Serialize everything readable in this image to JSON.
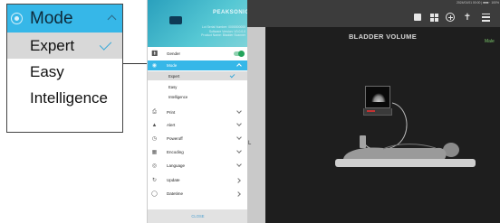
{
  "callout": {
    "header_label": "Mode",
    "options": [
      "Expert",
      "Easy",
      "Intelligence"
    ],
    "selected_index": 0
  },
  "menu": {
    "brand": "PEAKSONIC",
    "info_lines": [
      "Lot Serial Number: 0000000000",
      "Software Version: V0.0.0.0",
      "Product Name: Bladder Scanner"
    ],
    "items": [
      {
        "label": "Gender",
        "icon": "person-icon",
        "control": "toggle",
        "toggle_on": true
      },
      {
        "label": "Mode",
        "icon": "mode-icon",
        "control": "chevron-up",
        "expanded": true
      },
      {
        "label": "Print",
        "icon": "print-icon",
        "control": "chevron-down"
      },
      {
        "label": "Alert",
        "icon": "bell-icon",
        "control": "chevron-down"
      },
      {
        "label": "Poweroff",
        "icon": "clock-icon",
        "control": "chevron-down"
      },
      {
        "label": "Encoding",
        "icon": "qr-icon",
        "control": "chevron-down"
      },
      {
        "label": "Language",
        "icon": "globe-icon",
        "control": "chevron-down"
      },
      {
        "label": "Update",
        "icon": "refresh-icon",
        "control": "chevron-right"
      },
      {
        "label": "Datetime",
        "icon": "calendar-icon",
        "control": "chevron-right"
      }
    ],
    "mode_options": [
      "Expert",
      "Easy",
      "Intelligence"
    ],
    "mode_selected_index": 0,
    "footer_label": "CLOSE"
  },
  "app": {
    "status_text": "2024/01/01 00:00 | ■■■ · 100%",
    "title": "BLADDER VOLUME",
    "gender_label": "Male",
    "left_strip_text": "L",
    "toolbar_icons": [
      "square-icon",
      "grid-icon",
      "add-circle-icon",
      "person-icon",
      "list-icon"
    ]
  },
  "colors": {
    "accent": "#36b7e8",
    "toggle_on": "#22a35a",
    "gender": "#79c36a",
    "app_bg": "#1e1e1e"
  }
}
